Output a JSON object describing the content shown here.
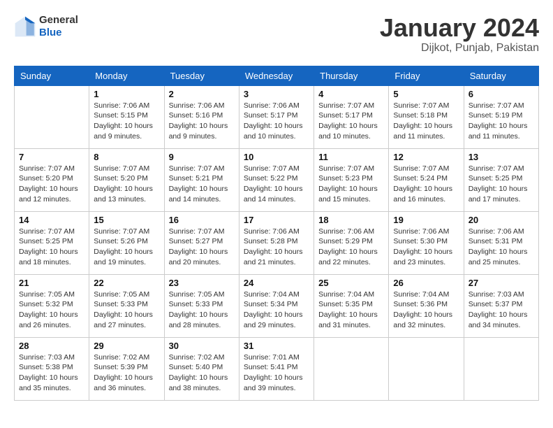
{
  "header": {
    "logo_general": "General",
    "logo_blue": "Blue",
    "title": "January 2024",
    "subtitle": "Dijkot, Punjab, Pakistan"
  },
  "days_of_week": [
    "Sunday",
    "Monday",
    "Tuesday",
    "Wednesday",
    "Thursday",
    "Friday",
    "Saturday"
  ],
  "weeks": [
    [
      {
        "day": "",
        "info": ""
      },
      {
        "day": "1",
        "info": "Sunrise: 7:06 AM\nSunset: 5:15 PM\nDaylight: 10 hours\nand 9 minutes."
      },
      {
        "day": "2",
        "info": "Sunrise: 7:06 AM\nSunset: 5:16 PM\nDaylight: 10 hours\nand 9 minutes."
      },
      {
        "day": "3",
        "info": "Sunrise: 7:06 AM\nSunset: 5:17 PM\nDaylight: 10 hours\nand 10 minutes."
      },
      {
        "day": "4",
        "info": "Sunrise: 7:07 AM\nSunset: 5:17 PM\nDaylight: 10 hours\nand 10 minutes."
      },
      {
        "day": "5",
        "info": "Sunrise: 7:07 AM\nSunset: 5:18 PM\nDaylight: 10 hours\nand 11 minutes."
      },
      {
        "day": "6",
        "info": "Sunrise: 7:07 AM\nSunset: 5:19 PM\nDaylight: 10 hours\nand 11 minutes."
      }
    ],
    [
      {
        "day": "7",
        "info": "Sunrise: 7:07 AM\nSunset: 5:20 PM\nDaylight: 10 hours\nand 12 minutes."
      },
      {
        "day": "8",
        "info": "Sunrise: 7:07 AM\nSunset: 5:20 PM\nDaylight: 10 hours\nand 13 minutes."
      },
      {
        "day": "9",
        "info": "Sunrise: 7:07 AM\nSunset: 5:21 PM\nDaylight: 10 hours\nand 14 minutes."
      },
      {
        "day": "10",
        "info": "Sunrise: 7:07 AM\nSunset: 5:22 PM\nDaylight: 10 hours\nand 14 minutes."
      },
      {
        "day": "11",
        "info": "Sunrise: 7:07 AM\nSunset: 5:23 PM\nDaylight: 10 hours\nand 15 minutes."
      },
      {
        "day": "12",
        "info": "Sunrise: 7:07 AM\nSunset: 5:24 PM\nDaylight: 10 hours\nand 16 minutes."
      },
      {
        "day": "13",
        "info": "Sunrise: 7:07 AM\nSunset: 5:25 PM\nDaylight: 10 hours\nand 17 minutes."
      }
    ],
    [
      {
        "day": "14",
        "info": "Sunrise: 7:07 AM\nSunset: 5:25 PM\nDaylight: 10 hours\nand 18 minutes."
      },
      {
        "day": "15",
        "info": "Sunrise: 7:07 AM\nSunset: 5:26 PM\nDaylight: 10 hours\nand 19 minutes."
      },
      {
        "day": "16",
        "info": "Sunrise: 7:07 AM\nSunset: 5:27 PM\nDaylight: 10 hours\nand 20 minutes."
      },
      {
        "day": "17",
        "info": "Sunrise: 7:06 AM\nSunset: 5:28 PM\nDaylight: 10 hours\nand 21 minutes."
      },
      {
        "day": "18",
        "info": "Sunrise: 7:06 AM\nSunset: 5:29 PM\nDaylight: 10 hours\nand 22 minutes."
      },
      {
        "day": "19",
        "info": "Sunrise: 7:06 AM\nSunset: 5:30 PM\nDaylight: 10 hours\nand 23 minutes."
      },
      {
        "day": "20",
        "info": "Sunrise: 7:06 AM\nSunset: 5:31 PM\nDaylight: 10 hours\nand 25 minutes."
      }
    ],
    [
      {
        "day": "21",
        "info": "Sunrise: 7:05 AM\nSunset: 5:32 PM\nDaylight: 10 hours\nand 26 minutes."
      },
      {
        "day": "22",
        "info": "Sunrise: 7:05 AM\nSunset: 5:33 PM\nDaylight: 10 hours\nand 27 minutes."
      },
      {
        "day": "23",
        "info": "Sunrise: 7:05 AM\nSunset: 5:33 PM\nDaylight: 10 hours\nand 28 minutes."
      },
      {
        "day": "24",
        "info": "Sunrise: 7:04 AM\nSunset: 5:34 PM\nDaylight: 10 hours\nand 29 minutes."
      },
      {
        "day": "25",
        "info": "Sunrise: 7:04 AM\nSunset: 5:35 PM\nDaylight: 10 hours\nand 31 minutes."
      },
      {
        "day": "26",
        "info": "Sunrise: 7:04 AM\nSunset: 5:36 PM\nDaylight: 10 hours\nand 32 minutes."
      },
      {
        "day": "27",
        "info": "Sunrise: 7:03 AM\nSunset: 5:37 PM\nDaylight: 10 hours\nand 34 minutes."
      }
    ],
    [
      {
        "day": "28",
        "info": "Sunrise: 7:03 AM\nSunset: 5:38 PM\nDaylight: 10 hours\nand 35 minutes."
      },
      {
        "day": "29",
        "info": "Sunrise: 7:02 AM\nSunset: 5:39 PM\nDaylight: 10 hours\nand 36 minutes."
      },
      {
        "day": "30",
        "info": "Sunrise: 7:02 AM\nSunset: 5:40 PM\nDaylight: 10 hours\nand 38 minutes."
      },
      {
        "day": "31",
        "info": "Sunrise: 7:01 AM\nSunset: 5:41 PM\nDaylight: 10 hours\nand 39 minutes."
      },
      {
        "day": "",
        "info": ""
      },
      {
        "day": "",
        "info": ""
      },
      {
        "day": "",
        "info": ""
      }
    ]
  ]
}
